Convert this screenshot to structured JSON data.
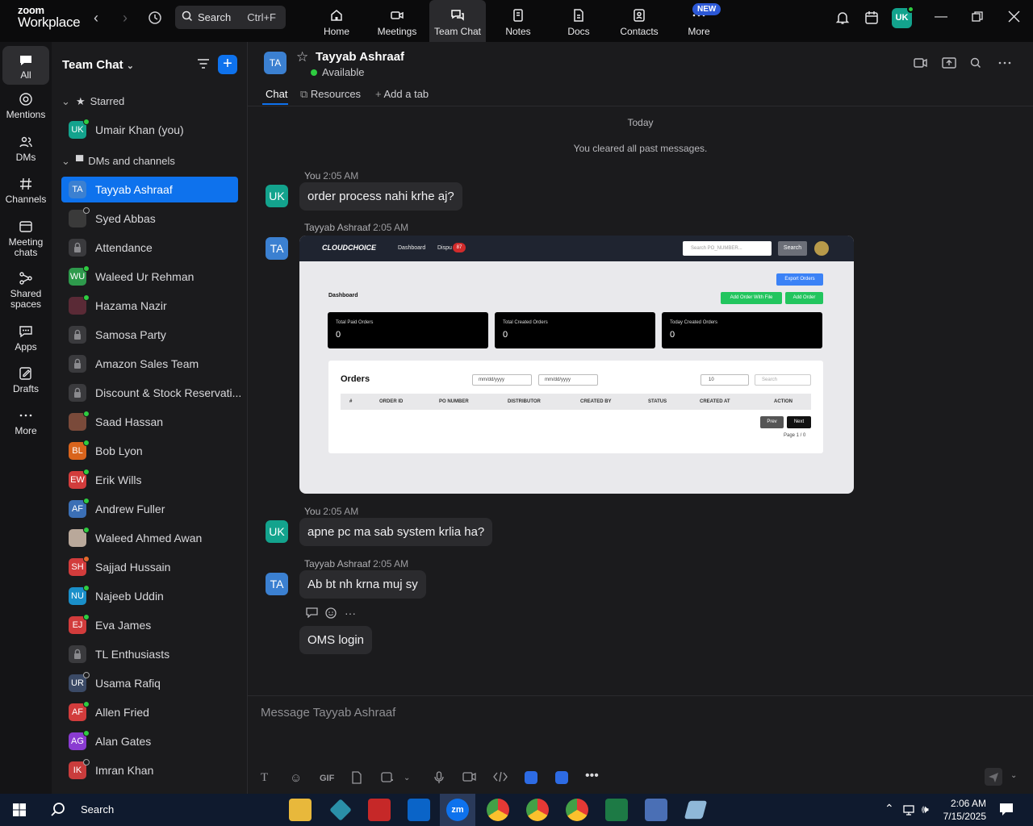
{
  "app": {
    "logo_top": "zoom",
    "logo_bottom": "Workplace"
  },
  "topbar": {
    "search_label": "Search",
    "search_shortcut": "Ctrl+F",
    "nav": [
      {
        "label": "Home",
        "icon": "home-icon"
      },
      {
        "label": "Meetings",
        "icon": "video-icon"
      },
      {
        "label": "Team Chat",
        "icon": "chat-icon",
        "active": true
      },
      {
        "label": "Notes",
        "icon": "notes-icon"
      },
      {
        "label": "Docs",
        "icon": "docs-icon"
      },
      {
        "label": "Contacts",
        "icon": "contacts-icon"
      },
      {
        "label": "More",
        "icon": "more-icon"
      }
    ],
    "new_badge": "NEW",
    "user_initials": "UK"
  },
  "rail": [
    {
      "label": "All",
      "active": true
    },
    {
      "label": "Mentions"
    },
    {
      "label": "DMs"
    },
    {
      "label": "Channels"
    },
    {
      "label": "Meeting chats"
    },
    {
      "label": "Shared spaces"
    },
    {
      "label": "Apps"
    },
    {
      "label": "Drafts"
    },
    {
      "label": "More"
    }
  ],
  "sidebar": {
    "title": "Team Chat",
    "sections": {
      "starred": "Starred",
      "dms": "DMs and channels"
    },
    "starred_items": [
      {
        "initials": "UK",
        "name": "Umair Khan (you)",
        "color": "#13a38d",
        "status": "g"
      }
    ],
    "items": [
      {
        "initials": "TA",
        "name": "Tayyab Ashraaf",
        "color": "#3b80d1",
        "selected": true
      },
      {
        "initials": "",
        "name": "Syed Abbas",
        "color": "#3a3a3a",
        "status": "o",
        "photo": true
      },
      {
        "initials": "",
        "name": "Attendance",
        "color": "#3a3a3d",
        "lock": true
      },
      {
        "initials": "WU",
        "name": "Waleed Ur Rehman",
        "color": "#2e9a4c",
        "status": "g"
      },
      {
        "initials": "",
        "name": "Hazama Nazir",
        "color": "#5a2a36",
        "status": "g",
        "photo": true
      },
      {
        "initials": "",
        "name": "Samosa Party",
        "color": "#3a3a3d",
        "lock": true
      },
      {
        "initials": "",
        "name": "Amazon Sales Team",
        "color": "#3a3a3d",
        "lock": true
      },
      {
        "initials": "",
        "name": "Discount & Stock Reservati...",
        "color": "#3a3a3d",
        "lock": true
      },
      {
        "initials": "",
        "name": "Saad Hassan",
        "color": "#7a4a3a",
        "status": "g",
        "photo": true
      },
      {
        "initials": "BL",
        "name": "Bob Lyon",
        "color": "#d9641c",
        "status": "g"
      },
      {
        "initials": "EW",
        "name": "Erik Wills",
        "color": "#d23c3c",
        "status": "g"
      },
      {
        "initials": "AF",
        "name": "Andrew Fuller",
        "color": "#3b6fb5",
        "status": "g"
      },
      {
        "initials": "",
        "name": "Waleed Ahmed Awan",
        "color": "#b9a89a",
        "status": "g",
        "photo": true
      },
      {
        "initials": "SH",
        "name": "Sajjad Hussain",
        "color": "#d23c3c",
        "status": "r"
      },
      {
        "initials": "NU",
        "name": "Najeeb Uddin",
        "color": "#1a8fc9",
        "status": "g"
      },
      {
        "initials": "EJ",
        "name": "Eva James",
        "color": "#d23c3c",
        "status": "g"
      },
      {
        "initials": "",
        "name": "TL Enthusiasts",
        "color": "#3a3a3d",
        "lock": true
      },
      {
        "initials": "UR",
        "name": "Usama Rafiq",
        "color": "#3b4a66",
        "status": "o"
      },
      {
        "initials": "AF",
        "name": "Allen Fried",
        "color": "#d23c3c",
        "status": "g"
      },
      {
        "initials": "AG",
        "name": "Alan Gates",
        "color": "#8a3bd1",
        "status": "g"
      },
      {
        "initials": "IK",
        "name": "Imran Khan",
        "color": "#c93c3c",
        "status": "o"
      }
    ]
  },
  "chat": {
    "contact_initials": "TA",
    "contact_name": "Tayyab Ashraaf",
    "contact_status": "Available",
    "tabs": [
      "Chat",
      "Resources",
      "Add a tab"
    ],
    "day_label": "Today",
    "system_message": "You cleared all past messages.",
    "messages": [
      {
        "sender": "You",
        "time": "2:05 AM",
        "initials": "UK",
        "text": "order process nahi krhe aj?"
      },
      {
        "sender": "Tayyab Ashraaf",
        "time": "2:05 AM",
        "initials": "TA",
        "text": ""
      },
      {
        "sender": "You",
        "time": "2:05 AM",
        "initials": "UK",
        "text": "apne pc ma sab system krlia ha?"
      },
      {
        "sender": "Tayyab Ashraaf",
        "time": "2:05 AM",
        "initials": "TA",
        "text": "Ab bt nh krna muj sy"
      },
      {
        "text": "OMS login"
      }
    ],
    "composer_placeholder": "Message Tayyab Ashraaf"
  },
  "screenshot": {
    "brand": "CLOUDCHOICE",
    "nav_dashboard": "Dashboard",
    "nav_dispute": "Dispu",
    "nav_badge": "87",
    "search_placeholder": "Search PO_NUMBER...",
    "search_btn": "Search",
    "page_title": "Dashboard",
    "export_btn": "Export Orders",
    "add_file_btn": "Add Order With File",
    "add_btn": "Add Order",
    "cards": [
      {
        "label": "Total Paid Orders",
        "value": "0"
      },
      {
        "label": "Total Created Orders",
        "value": "0"
      },
      {
        "label": "Today Created Orders",
        "value": "0"
      }
    ],
    "orders_title": "Orders",
    "date_ph": "mm/dd/yyyy",
    "page_size": "10",
    "table_search": "Search",
    "columns": [
      "#",
      "ORDER ID",
      "PO NUMBER",
      "DISTRIBUTOR",
      "CREATED BY",
      "STATUS",
      "CREATED AT",
      "ACTION"
    ],
    "prev": "Prev",
    "next": "Next",
    "page_info": "Page 1 / 0"
  },
  "taskbar": {
    "search": "Search",
    "time": "2:06 AM",
    "date": "7/15/2025"
  }
}
